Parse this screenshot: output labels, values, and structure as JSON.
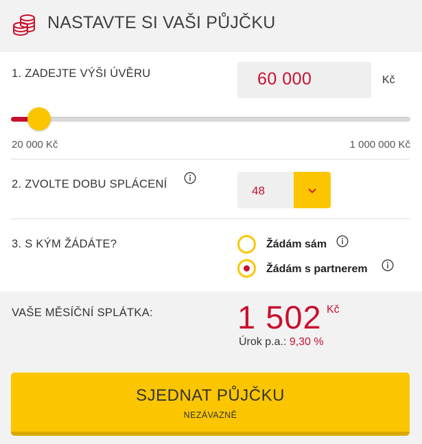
{
  "header": {
    "title": "NASTAVTE SI VAŠI PŮJČKU",
    "logo_icon": "coins-stack-icon"
  },
  "amount": {
    "label": "1. ZADEJTE VÝŠI ÚVĚRU",
    "value": "60 000",
    "unit": "Kč",
    "slider": {
      "min_label": "20 000 Kč",
      "max_label": "1 000 000 Kč",
      "min": 20000,
      "max": 1000000,
      "current": 60000
    }
  },
  "term": {
    "label": "2. ZVOLTE DOBU SPLÁCENÍ",
    "value": "48",
    "dropdown_icon": "chevron-down-icon",
    "info_icon": "info-icon"
  },
  "applicant": {
    "label": "3. S KÝM ŽÁDÁTE?",
    "options": [
      {
        "label": "Žádám sám",
        "selected": false
      },
      {
        "label": "Žádám s partnerem",
        "selected": true
      }
    ]
  },
  "result": {
    "monthly_label": "VAŠE MĚSÍČNÍ SPLÁTKA:",
    "monthly_value": "1 502",
    "monthly_unit": "Kč",
    "rate_label": "Úrok p.a.:",
    "rate_value": "9,30 %"
  },
  "cta": {
    "label": "SJEDNAT PŮJČKU",
    "sublabel": "NEZÁVAZNĚ"
  },
  "colors": {
    "accent_red": "#c8102e",
    "accent_yellow": "#fbc600",
    "panel_gray": "#f2f2f2"
  }
}
